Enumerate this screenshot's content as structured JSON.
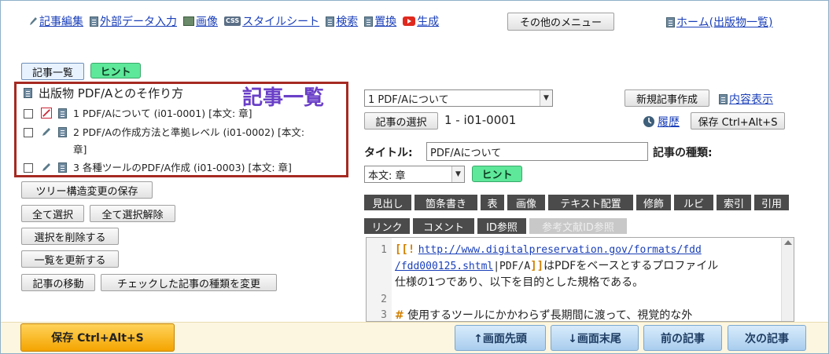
{
  "menu": {
    "edit": "記事編集",
    "import": "外部データ入力",
    "image": "画像",
    "css_badge": "CSS",
    "stylesheet": "スタイルシート",
    "search": "検索",
    "replace": "置換",
    "generate": "生成",
    "other": "その他のメニュー",
    "home": "ホーム(出版物一覧)"
  },
  "left": {
    "tab_list": "記事一覧",
    "tab_hint": "ヒント",
    "publication_title": "出版物 PDF/Aとのそ作り方",
    "heading": "記事一覧",
    "items": [
      {
        "label": "1 PDF/Aについて (i01-0001) [本文: 章]"
      },
      {
        "label": "2 PDF/Aの作成方法と準拠レベル (i01-0002) [本文: 章]"
      },
      {
        "label": "3 各種ツールのPDF/A作成 (i01-0003) [本文: 章]"
      }
    ],
    "save_tree": "ツリー構造変更の保存",
    "select_all": "全て選択",
    "deselect_all": "全て選択解除",
    "delete_selected": "選択を削除する",
    "refresh_list": "一覧を更新する",
    "move_article": "記事の移動",
    "change_type": "チェックした記事の種類を変更"
  },
  "right": {
    "article_select_value": "1 PDF/Aについて",
    "new_article": "新規記事作成",
    "show_content": "内容表示",
    "choose_article": "記事の選択",
    "article_id": "1 - i01-0001",
    "history": "履歴",
    "save_shortcut": "保存 Ctrl+Alt+S",
    "title_label": "タイトル:",
    "title_value": "PDF/Aについて",
    "type_label": "記事の種類:",
    "type_value": "本文: 章",
    "hint": "ヒント",
    "toolbar1": [
      "見出し",
      "箇条書き",
      "表",
      "画像",
      "テキスト配置",
      "修飾",
      "ルビ",
      "索引",
      "引用"
    ],
    "toolbar2": [
      "リンク",
      "コメント",
      "ID参照",
      "参考文献ID参照"
    ]
  },
  "editor": {
    "lines": [
      "1",
      "2",
      "3"
    ],
    "l1_open": "[[!",
    "l1_url": "http://www.digitalpreservation.gov/formats/fdd",
    "l1b_url": "/fdd000125.shtml",
    "l1b_sep": "|PDF/A",
    "l1b_close": "]]",
    "l1b_text": "はPDFをベースとするプロファイル",
    "l1c_text": "仕様の1つであり、以下を目的とした規格である。",
    "l3_hash": "#",
    "l3_text": " 使用するツールにかかわらず長期間に渡って、視覚的な外"
  },
  "bottom": {
    "save": "保存 Ctrl+Alt+S",
    "top": "↑画面先頭",
    "end": "↓画面末尾",
    "prev": "前の記事",
    "next": "次の記事"
  },
  "colors": {
    "link": "#1a3fb8",
    "hint_green": "#5ee89a",
    "list_border": "#a52a22",
    "heading_purple": "#6a3fc8",
    "save_orange": "#f4a400",
    "nav_blue": "#a9cdee",
    "toolbar_dark": "#4b4b4b"
  }
}
